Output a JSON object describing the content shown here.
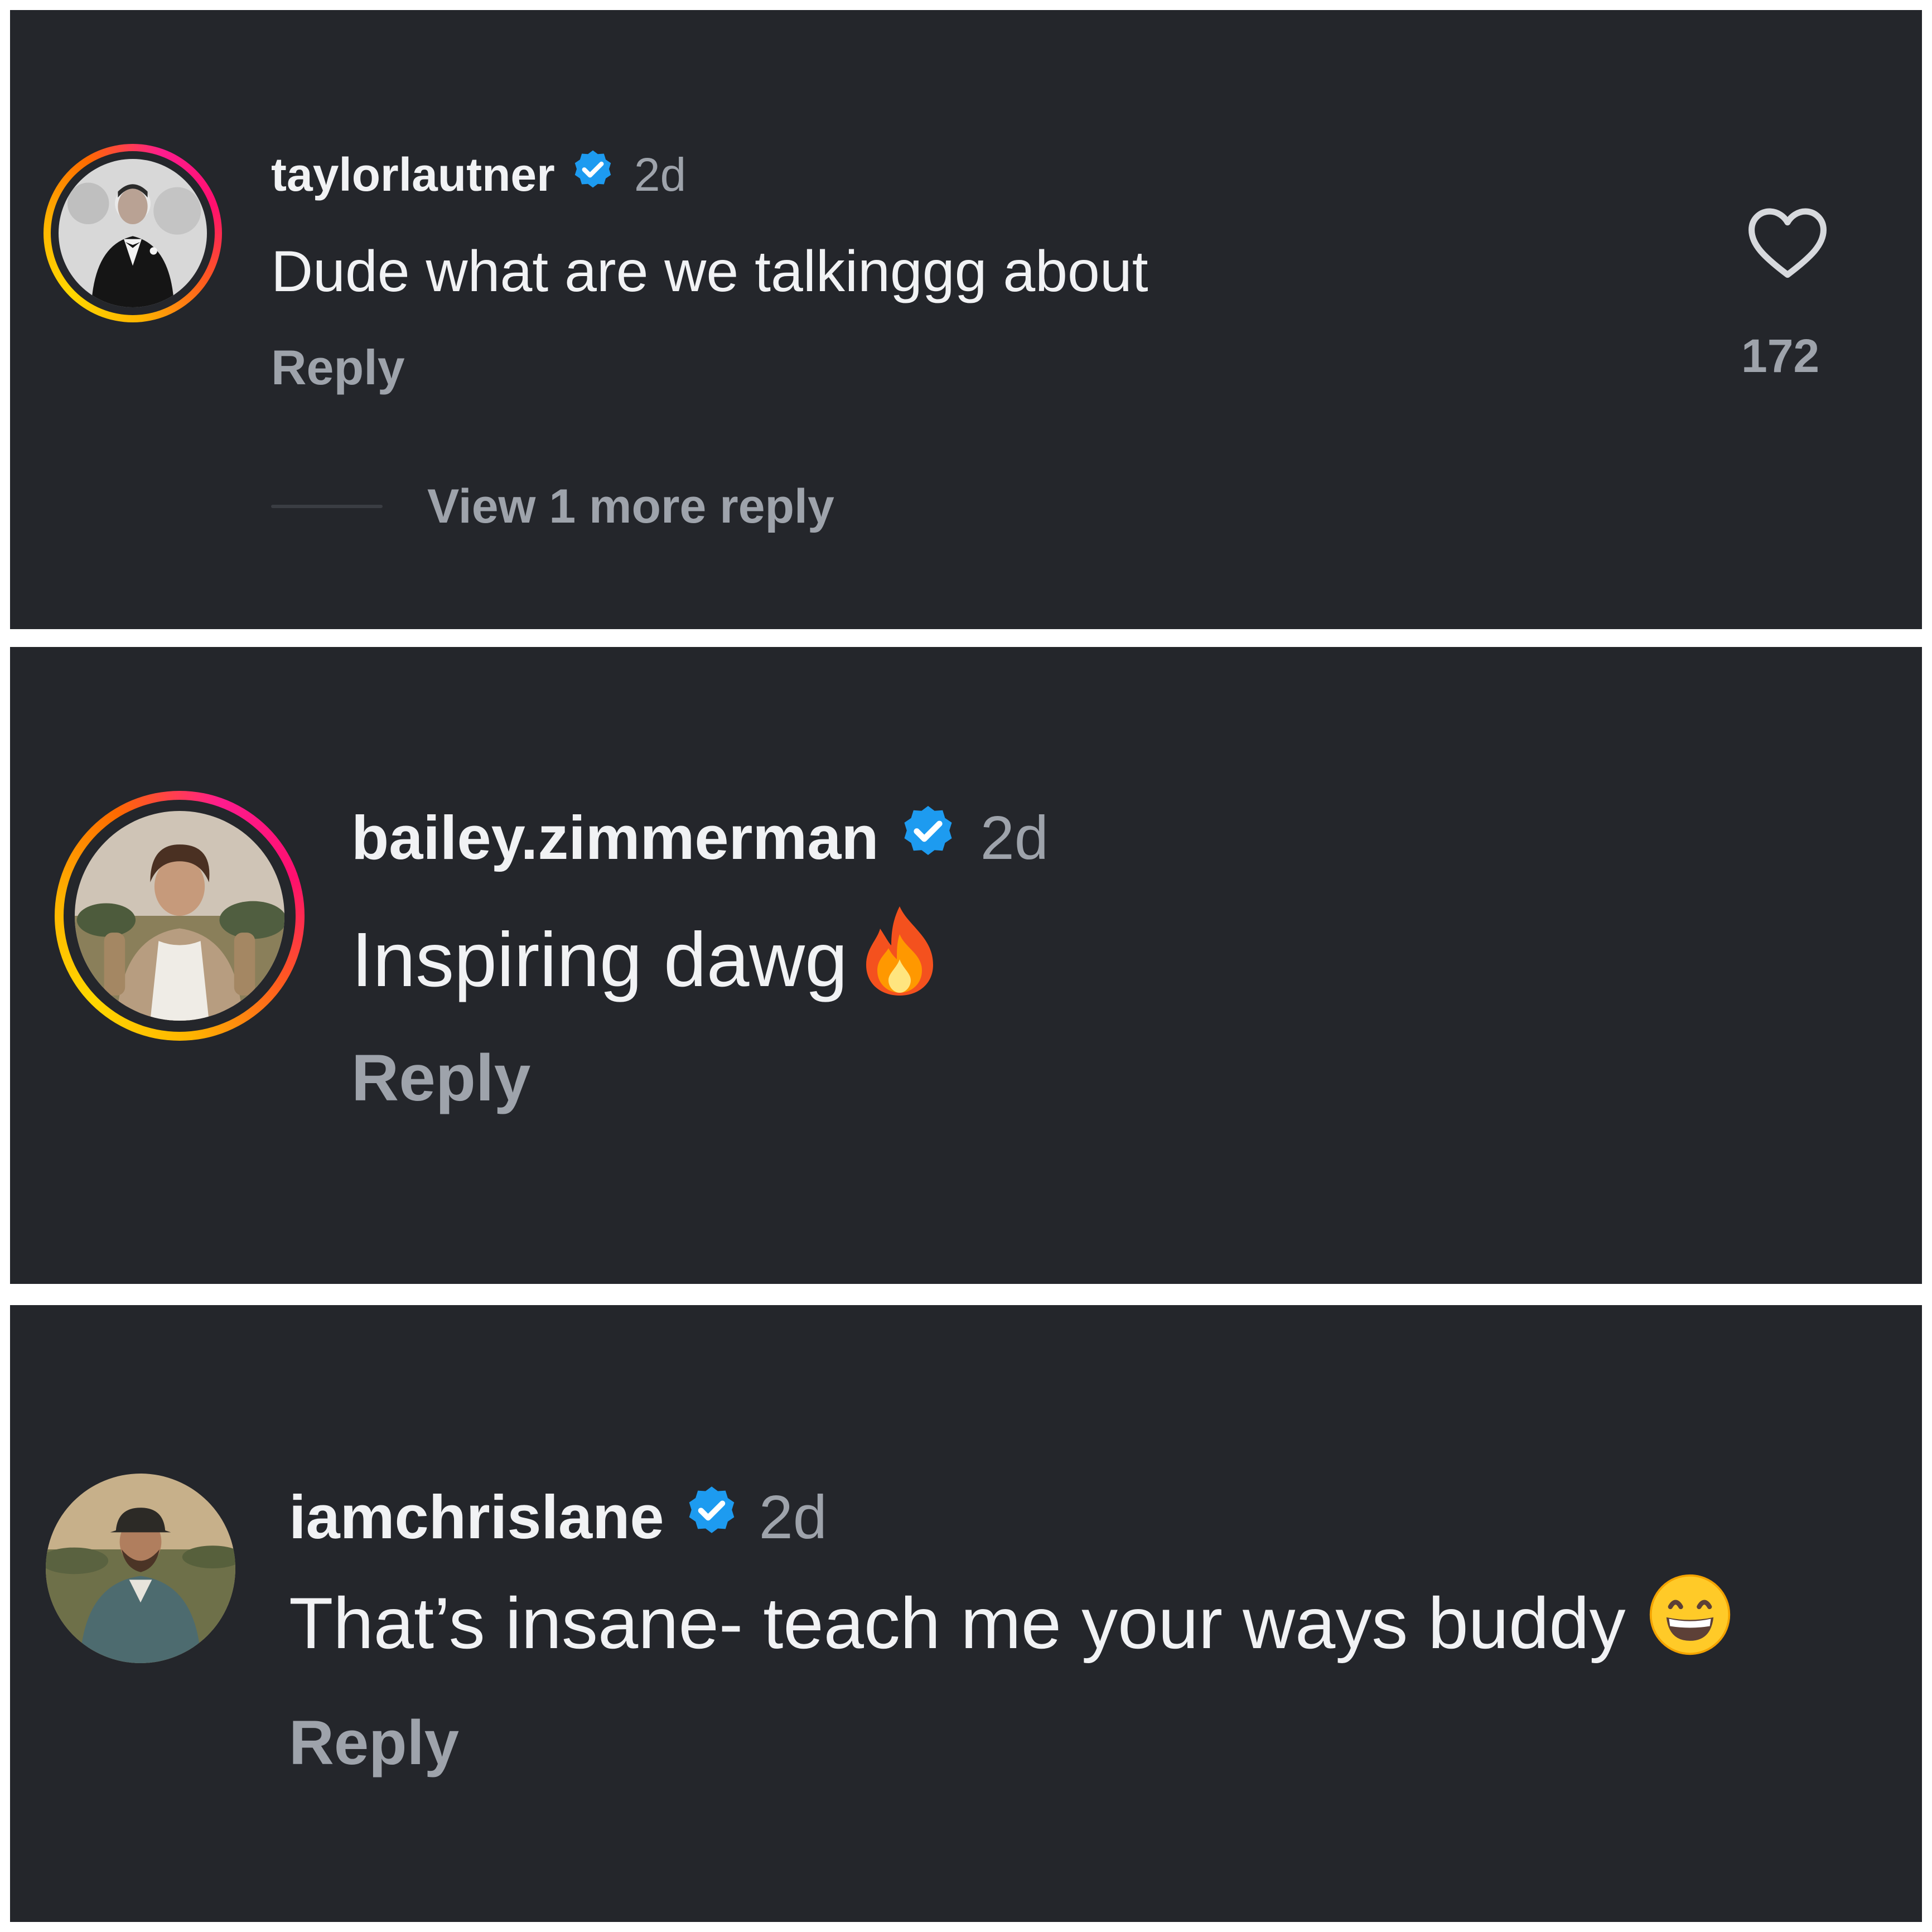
{
  "comments": [
    {
      "username": "taylorlautner",
      "verified_icon": "verified-badge-icon",
      "time": "2d",
      "text": "Dude what are we talkinggg about",
      "reply_label": "Reply",
      "like_count": "172",
      "view_replies_label": "View 1 more reply",
      "story_ring": true
    },
    {
      "username": "bailey.zimmerman",
      "verified_icon": "verified-badge-icon",
      "time": "2d",
      "text": "Inspiring dawg",
      "emoji": "fire-emoji",
      "reply_label": "Reply",
      "story_ring": true
    },
    {
      "username": "iamchrislane",
      "verified_icon": "verified-badge-icon",
      "time": "2d",
      "text": "That’s insane- teach me your ways buddy",
      "emoji": "grinning-face-emoji",
      "reply_label": "Reply",
      "story_ring": false
    }
  ],
  "colors": {
    "background": "#24262b",
    "primary_text": "#f1f2f4",
    "secondary_text": "#9ea3ab",
    "verified_blue": "#1d9bf0"
  }
}
